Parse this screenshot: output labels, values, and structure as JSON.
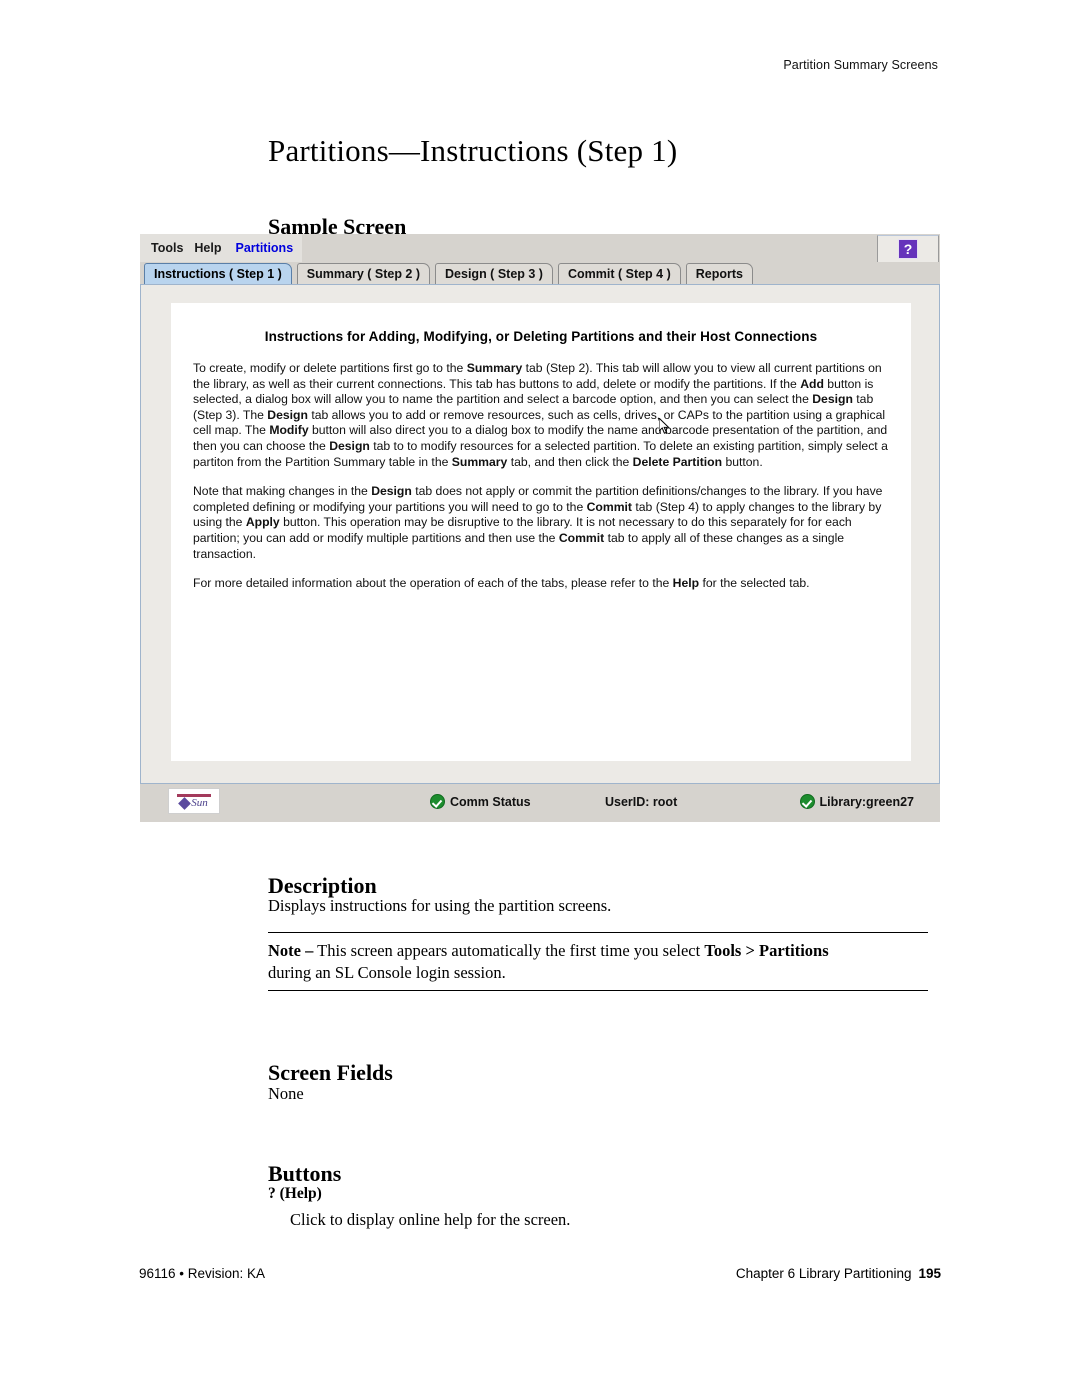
{
  "page": {
    "running_head": "Partition Summary Screens",
    "chapter_title": "Partitions—Instructions (Step 1)",
    "footer_left": "96116 • Revision: KA",
    "footer_right": "Chapter 6 Library Partitioning",
    "page_number": "195"
  },
  "sections": {
    "sample_screen_heading": "Sample Screen",
    "description_heading": "Description",
    "description_text": "Displays instructions for using the partition screens.",
    "note_label": "Note –",
    "note_text_1": " This screen appears automatically the first time you select ",
    "note_bold": "Tools > Partitions",
    "note_text_2": "during an SL Console login session.",
    "screen_fields_heading": "Screen Fields",
    "screen_fields_text": "None",
    "buttons_heading": "Buttons",
    "button_help_label": "? (Help)",
    "button_help_text": "Click to display online help for the screen."
  },
  "app": {
    "menubar": {
      "items": [
        {
          "label": "Tools",
          "accent": false
        },
        {
          "label": "Help",
          "accent": false
        },
        {
          "label": "Partitions",
          "accent": true
        }
      ],
      "help_button": "?"
    },
    "tabs": [
      {
        "label": "Instructions ( Step 1 )",
        "selected": true
      },
      {
        "label": "Summary ( Step 2 )",
        "selected": false
      },
      {
        "label": "Design ( Step 3 )",
        "selected": false
      },
      {
        "label": "Commit ( Step 4 )",
        "selected": false
      },
      {
        "label": "Reports",
        "selected": false
      }
    ],
    "content": {
      "title": "Instructions for Adding, Modifying, or Deleting Partitions and their Host Connections",
      "paragraph_1": {
        "p1": "To create, modify or delete partitions first go to the ",
        "b1": "Summary",
        "p2": " tab (Step 2). This tab will allow you to view all current partitions on the library, as well as their current connections. This tab has buttons to add, delete or modify the partitions. If the ",
        "b2": "Add",
        "p3": " button is selected, a dialog box will allow you to name the partition and select a barcode option, and then you can select the ",
        "b3": "Design",
        "p4": " tab (Step 3). The ",
        "b4": "Design",
        "p5": " tab allows you to add or remove resources, such as cells, drives, or CAPs to the partition using a graphical cell map. The ",
        "b5": "Modify",
        "p6": " button will also direct you to a dialog box to modify the name and barcode presentation of the partition, and then you can choose the ",
        "b6": "Design",
        "p7": " tab to to modify resources for a selected partition. To delete an existing partition, simply select a partiton from the Partition Summary table in the ",
        "b7": "Summary",
        "p8": " tab, and then click the ",
        "b8": "Delete Partition",
        "p9": " button."
      },
      "paragraph_2": {
        "p1": "Note that making changes in the ",
        "b1": "Design",
        "p2": " tab does not apply or commit the partition definitions/changes to the library. If you have completed defining or modifying your partitions you will need to go to the ",
        "b2": "Commit",
        "p3": " tab (Step 4) to apply changes to the library by using the ",
        "b3": "Apply",
        "p4": " button. This operation may be disruptive to the library. It is not necessary to do this separately for for each partition; you can add or modify multiple partitions and then use the ",
        "b4": "Commit",
        "p5": " tab to apply all of these changes as a single transaction."
      },
      "paragraph_3": {
        "p1": "For more detailed information about the operation of each of the tabs, please refer to the ",
        "b1": "Help",
        "p2": " for the selected tab."
      }
    },
    "statusbar": {
      "logo_text": "Sun",
      "comm_status": "Comm Status",
      "user_id": "UserID: root",
      "library": "Library:green27"
    }
  },
  "colors": {
    "accent_blue": "#0000dd",
    "tab_selected": "#b9d4ee",
    "help_purple": "#6633bb",
    "status_green": "#1d8c2e",
    "panel_grey": "#d6d3ce"
  }
}
